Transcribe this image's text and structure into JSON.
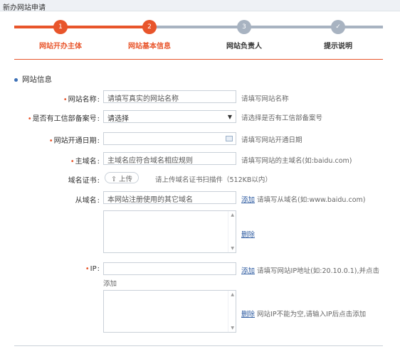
{
  "header": {
    "title": "新办网站申请"
  },
  "steps": [
    {
      "number": "1",
      "label": "网站开办主体",
      "state": "done"
    },
    {
      "number": "2",
      "label": "网站基本信息",
      "state": "current"
    },
    {
      "number": "3",
      "label": "网站负责人",
      "state": "todo"
    },
    {
      "number": "✓",
      "label": "提示说明",
      "state": "todo"
    }
  ],
  "colors": {
    "accent": "#e8552b",
    "inactive": "#a8b3c1",
    "link": "#2c5aa0"
  },
  "section": {
    "title": "网站信息"
  },
  "form": {
    "site_name": {
      "label": "网站名称",
      "placeholder": "请填写真实的网站名称",
      "hint": "请填写网站名称"
    },
    "icp": {
      "label": "是否有工信部备案号",
      "value": "请选择",
      "hint": "请选择是否有工信部备案号"
    },
    "open_date": {
      "label": "网站开通日期",
      "hint": "请填写网站开通日期"
    },
    "main_domain": {
      "label": "主域名",
      "placeholder": "主域名应符合域名相应规则",
      "hint": "请填写网站的主域名(如:baidu.com)"
    },
    "domain_cert": {
      "label": "域名证书",
      "button": "上传",
      "hint": "请上传域名证书扫描件（512KB以内）"
    },
    "sub_domain": {
      "label": "从域名",
      "placeholder": "本网站注册使用的其它域名",
      "add": "添加",
      "hint": "请填写从域名(如:www.baidu.com)",
      "delete": "删除"
    },
    "ip": {
      "label": "IP",
      "add": "添加",
      "hint": "请填写网站IP地址(如:20.10.0.1),并点击",
      "hint2": "添加",
      "delete": "删除",
      "delete_hint": "网站IP不能为空,请输入IP后点击添加"
    }
  }
}
